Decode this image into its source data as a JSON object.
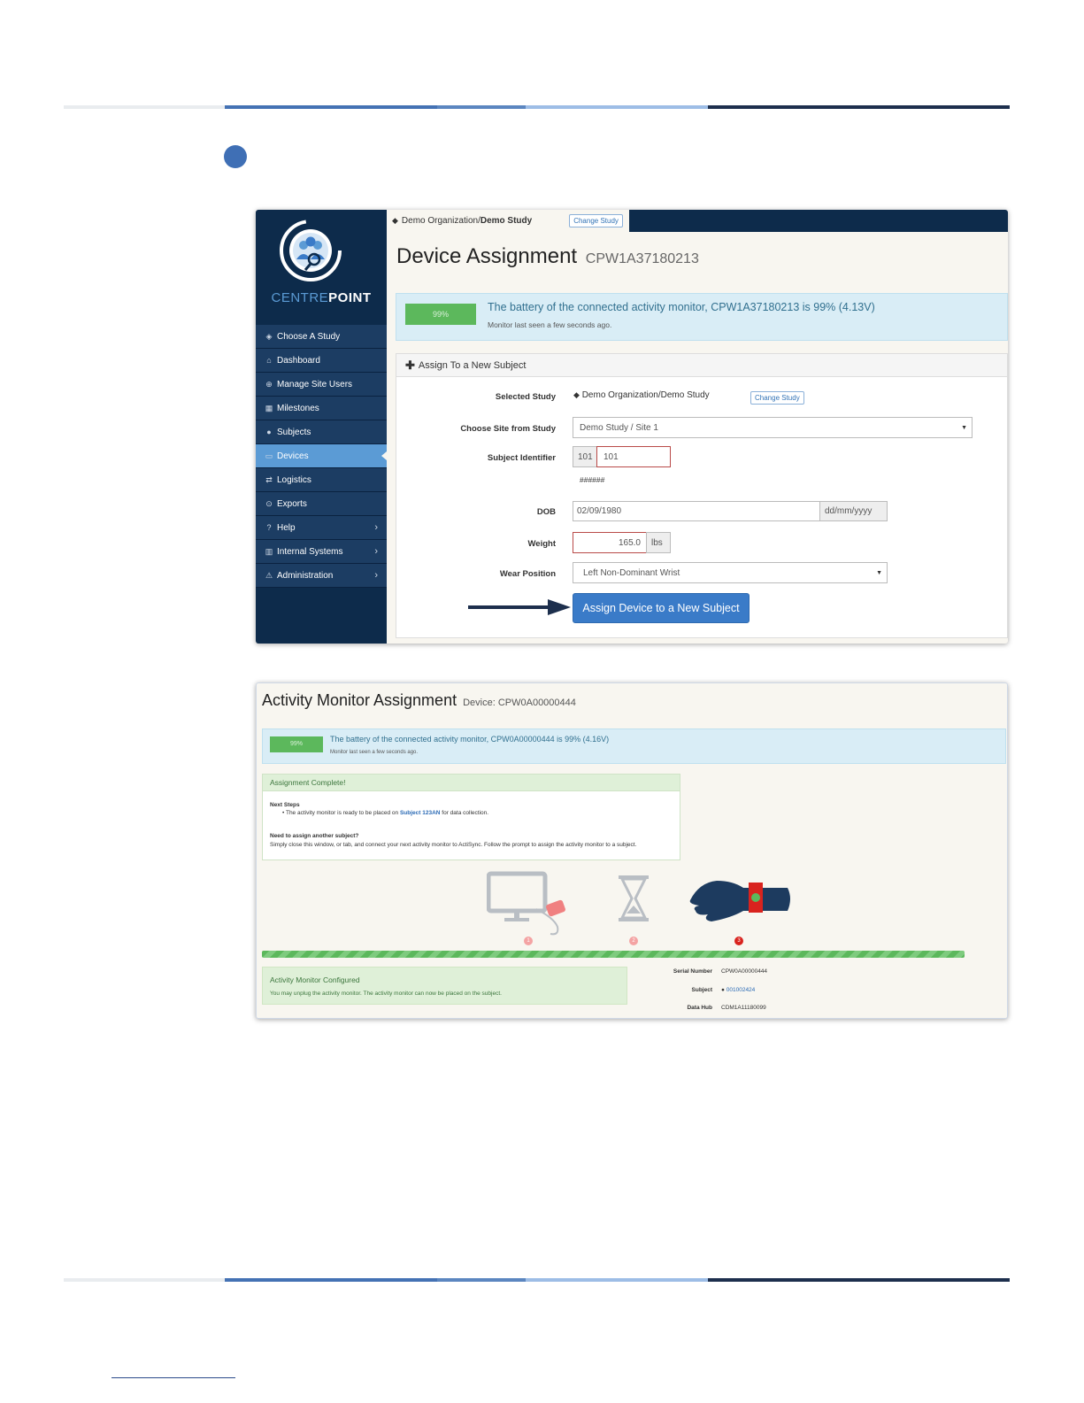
{
  "app": {
    "logo_light": "CENTRE",
    "logo_bold": "POINT"
  },
  "sidebar": {
    "items": [
      {
        "label": "Choose A Study",
        "icon": "tag-icon",
        "glyph": "◈"
      },
      {
        "label": "Dashboard",
        "icon": "home-icon",
        "glyph": "⌂"
      },
      {
        "label": "Manage Site Users",
        "icon": "plus-circle-icon",
        "glyph": "⊕"
      },
      {
        "label": "Milestones",
        "icon": "calendar-icon",
        "glyph": "▦"
      },
      {
        "label": "Subjects",
        "icon": "user-icon",
        "glyph": "●"
      },
      {
        "label": "Devices",
        "icon": "device-icon",
        "glyph": "▭",
        "active": true
      },
      {
        "label": "Logistics",
        "icon": "swap-icon",
        "glyph": "⇄"
      },
      {
        "label": "Exports",
        "icon": "download-icon",
        "glyph": "⊙"
      },
      {
        "label": "Help",
        "icon": "question-icon",
        "glyph": "?",
        "chevron": "›"
      },
      {
        "label": "Internal Systems",
        "icon": "barcode-icon",
        "glyph": "▥",
        "chevron": "›"
      },
      {
        "label": "Administration",
        "icon": "warning-icon",
        "glyph": "⚠",
        "chevron": "›"
      }
    ]
  },
  "breadcrumb": {
    "org": "Demo Organization/",
    "study": "Demo Study",
    "change_label": "Change Study"
  },
  "device_assignment": {
    "title": "Device Assignment",
    "device_id": "CPW1A37180213",
    "battery": {
      "percent_label": "99%",
      "percent_value": 99,
      "message": "The battery of the connected activity monitor, CPW1A37180213 is 99% (4.13V)",
      "last_seen": "Monitor last seen a few seconds ago."
    },
    "panel_title": "Assign To a New Subject",
    "form": {
      "selected_study_label": "Selected Study",
      "selected_study_value": "Demo Organization/Demo Study",
      "change_study_label": "Change Study",
      "site_label": "Choose Site from Study",
      "site_value": "Demo Study / Site 1",
      "subject_id_label": "Subject Identifier",
      "subject_prefix": "101",
      "subject_value": "101",
      "subject_hint": "######",
      "dob_label": "DOB",
      "dob_value": "02/09/1980",
      "dob_format": "dd/mm/yyyy",
      "weight_label": "Weight",
      "weight_value": "165.0",
      "weight_unit": "lbs",
      "wear_label": "Wear Position",
      "wear_value": "Left Non-Dominant Wrist",
      "submit_label": "Assign Device to a New Subject"
    }
  },
  "activity_monitor": {
    "title": "Activity Monitor Assignment",
    "device_label": "Device: CPW0A00000444",
    "battery": {
      "percent_label": "99%",
      "percent_value": 99,
      "message": "The battery of the connected activity monitor, CPW0A00000444 is 99% (4.16V)",
      "last_seen": "Monitor last seen a few seconds ago."
    },
    "complete": {
      "title": "Assignment Complete!",
      "next_steps_label": "Next Steps",
      "next_steps_pre": "The activity monitor is ready to be placed on ",
      "next_steps_subject": "Subject 123AN",
      "next_steps_post": " for data collection.",
      "another_label": "Need to assign another subject?",
      "another_text": "Simply close this window, or tab, and connect your next activity monitor to ActiSync. Follow the prompt to assign the activity monitor to a subject."
    },
    "steps": [
      "1",
      "2",
      "3"
    ],
    "progress_percent": 100,
    "configured": {
      "title": "Activity Monitor Configured",
      "text": "You may unplug the activity monitor. The activity monitor can now be placed on the subject."
    },
    "details": {
      "serial_label": "Serial Number",
      "serial_value": "CPW0A00000444",
      "subject_label": "Subject",
      "subject_value": "001002424",
      "hub_label": "Data Hub",
      "hub_value": "CDM1A11180099"
    }
  },
  "colors": {
    "navy": "#0d2b4b",
    "accent": "#3a7bc8",
    "success": "#5cb85c",
    "info_bg": "#d9edf6"
  }
}
